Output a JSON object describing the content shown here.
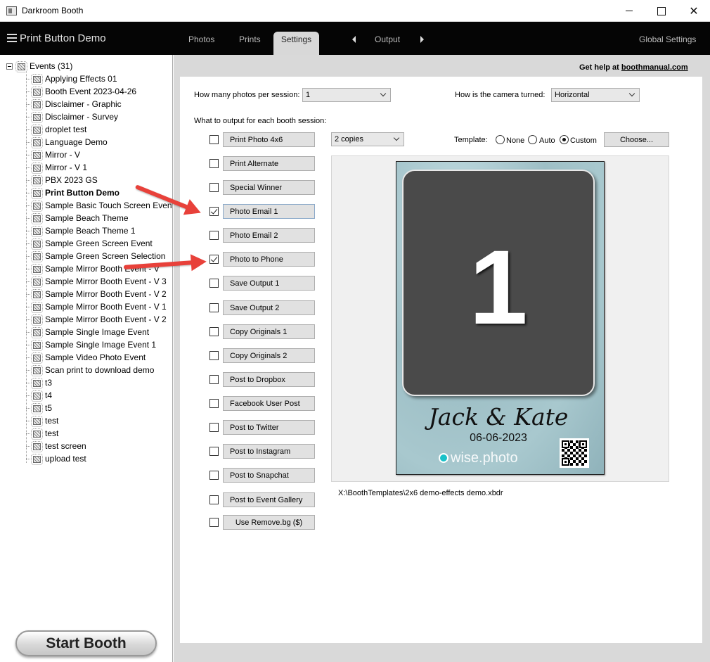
{
  "window": {
    "title": "Darkroom Booth"
  },
  "header": {
    "app_name": "Print Button Demo",
    "tabs": [
      "Photos",
      "Prints",
      "Settings"
    ],
    "output_label": "Output",
    "global_settings": "Global Settings"
  },
  "sidebar": {
    "root_label": "Events (31)",
    "items": [
      "Applying Effects 01",
      "Booth Event 2023-04-26",
      "Disclaimer - Graphic",
      "Disclaimer - Survey",
      "droplet test",
      "Language Demo",
      "Mirror - V",
      "Mirror - V  1",
      "PBX 2023 GS",
      "Print Button Demo",
      "Sample Basic Touch Screen Event",
      "Sample Beach Theme",
      "Sample Beach Theme  1",
      "Sample Green Screen Event",
      "Sample Green Screen Selection",
      "Sample Mirror Booth Event - V",
      "Sample Mirror Booth Event - V   3",
      "Sample Mirror Booth Event - V   2",
      "Sample Mirror Booth Event - V  1",
      "Sample Mirror Booth Event - V  2",
      "Sample Single Image Event",
      "Sample Single Image Event  1",
      "Sample Video Photo Event",
      "Scan print to download demo",
      "t3",
      "t4",
      "t5",
      "test",
      "test",
      "test screen",
      "upload test"
    ],
    "selected_index": 9,
    "start_booth": "Start Booth"
  },
  "main": {
    "help_prefix": "Get help at ",
    "help_link": "boothmanual.com",
    "photos_per_session_label": "How many photos per session:",
    "photos_per_session_value": "1",
    "camera_label": "How is the camera turned:",
    "camera_value": "Horizontal",
    "output_heading": "What to output for each booth session:",
    "copies_value": "2 copies",
    "template_label": "Template:",
    "template_options": [
      "None",
      "Auto",
      "Custom"
    ],
    "template_selected": "Custom",
    "choose_button": "Choose...",
    "template_path": "X:\\BoothTemplates\\2x6 demo-effects demo.xbdr",
    "outputs": [
      {
        "label": "Print Photo  4x6",
        "checked": false
      },
      {
        "label": "Print Alternate",
        "checked": false
      },
      {
        "label": "Special Winner",
        "checked": false
      },
      {
        "label": "Photo Email 1",
        "checked": true
      },
      {
        "label": "Photo Email 2",
        "checked": false
      },
      {
        "label": "Photo to Phone",
        "checked": true
      },
      {
        "label": "Save Output 1",
        "checked": false
      },
      {
        "label": "Save Output 2",
        "checked": false
      },
      {
        "label": "Copy Originals 1",
        "checked": false
      },
      {
        "label": "Copy Originals 2",
        "checked": false
      },
      {
        "label": "Post to Dropbox",
        "checked": false
      },
      {
        "label": "Facebook User Post",
        "checked": false
      },
      {
        "label": "Post to Twitter",
        "checked": false
      },
      {
        "label": "Post to Instagram",
        "checked": false
      },
      {
        "label": "Post to Snapchat",
        "checked": false
      },
      {
        "label": "Post to Event Gallery",
        "checked": false
      },
      {
        "label": "Use Remove.bg ($)",
        "checked": false
      }
    ]
  },
  "preview": {
    "slot_number": "1",
    "names": "Jack & Kate",
    "date": "06-06-2023",
    "brand": "wise.photo"
  },
  "colors": {
    "header_bg": "#050505",
    "arrow": "#e8413a",
    "template_bg": "#a8c8ce"
  }
}
